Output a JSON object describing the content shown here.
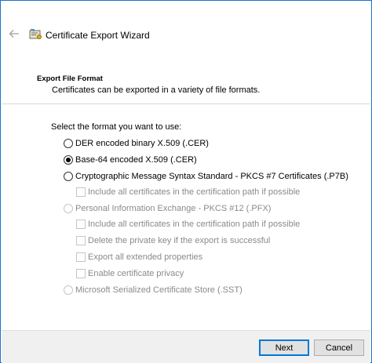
{
  "window": {
    "title": "Certificate Export Wizard",
    "border_color": "#1a73c9"
  },
  "header": {
    "section_title": "Export File Format",
    "section_description": "Certificates can be exported in a variety of file formats."
  },
  "content": {
    "prompt": "Select the format you want to use:",
    "options": [
      {
        "label": "DER encoded binary X.509 (.CER)",
        "type": "radio",
        "checked": false,
        "enabled": true
      },
      {
        "label": "Base-64 encoded X.509 (.CER)",
        "type": "radio",
        "checked": true,
        "enabled": true
      },
      {
        "label": "Cryptographic Message Syntax Standard - PKCS #7 Certificates (.P7B)",
        "type": "radio",
        "checked": false,
        "enabled": true
      },
      {
        "label": "Include all certificates in the certification path if possible",
        "type": "checkbox",
        "checked": false,
        "enabled": false
      },
      {
        "label": "Personal Information Exchange - PKCS #12 (.PFX)",
        "type": "radio",
        "checked": false,
        "enabled": false
      },
      {
        "label": "Include all certificates in the certification path if possible",
        "type": "checkbox",
        "checked": false,
        "enabled": false
      },
      {
        "label": "Delete the private key if the export is successful",
        "type": "checkbox",
        "checked": false,
        "enabled": false
      },
      {
        "label": "Export all extended properties",
        "type": "checkbox",
        "checked": false,
        "enabled": false
      },
      {
        "label": "Enable certificate privacy",
        "type": "checkbox",
        "checked": false,
        "enabled": false
      },
      {
        "label": "Microsoft Serialized Certificate Store (.SST)",
        "type": "radio",
        "checked": false,
        "enabled": false
      }
    ]
  },
  "footer": {
    "next_label": "Next",
    "cancel_label": "Cancel",
    "primary_color": "#0078d7"
  },
  "icons": {
    "back": "arrow-left-icon",
    "wizard": "certificate-icon"
  }
}
